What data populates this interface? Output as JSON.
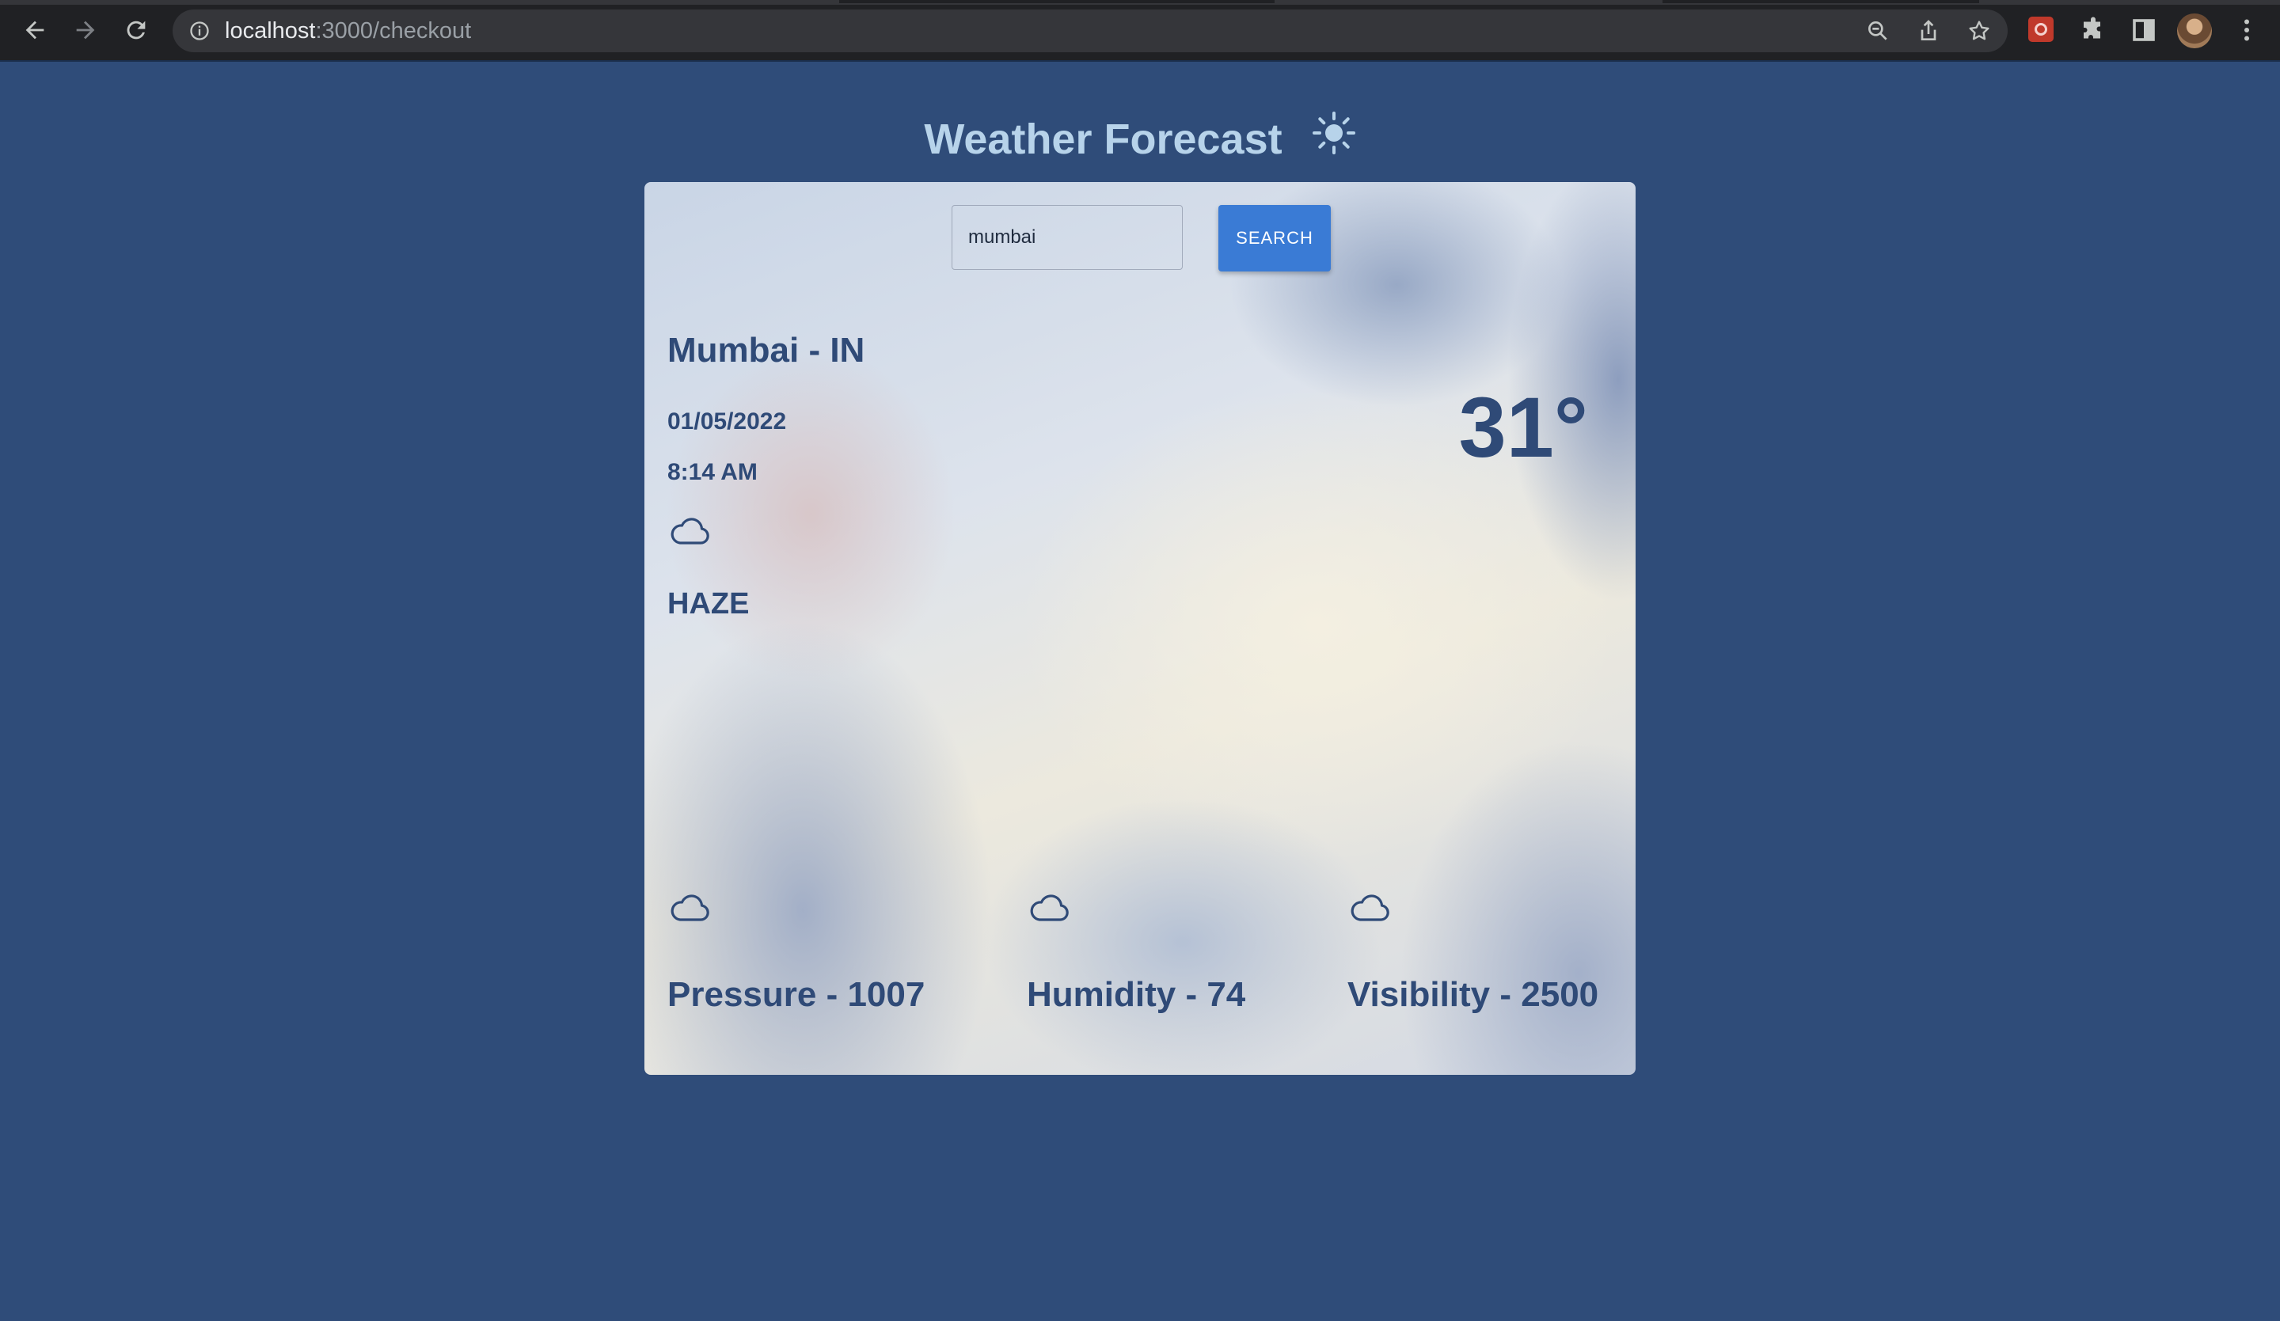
{
  "browser": {
    "url_host": "localhost",
    "url_path": ":3000/checkout"
  },
  "page": {
    "title": "Weather Forecast",
    "title_icon": "sun-icon"
  },
  "search": {
    "value": "mumbai",
    "button_label": "SEARCH"
  },
  "weather": {
    "location": "Mumbai - IN",
    "date": "01/05/2022",
    "time": "8:14 AM",
    "temperature": "31°",
    "condition_icon": "cloud-icon",
    "condition": "HAZE"
  },
  "stats": [
    {
      "icon": "cloud-icon",
      "label": "Pressure - 1007"
    },
    {
      "icon": "cloud-icon",
      "label": "Humidity - 74"
    },
    {
      "icon": "cloud-icon",
      "label": "Visibility - 2500"
    }
  ],
  "colors": {
    "page_background": "#2f4c79",
    "title": "#b7d3ea",
    "text": "#2f4a77",
    "button": "#3a7bd5"
  }
}
